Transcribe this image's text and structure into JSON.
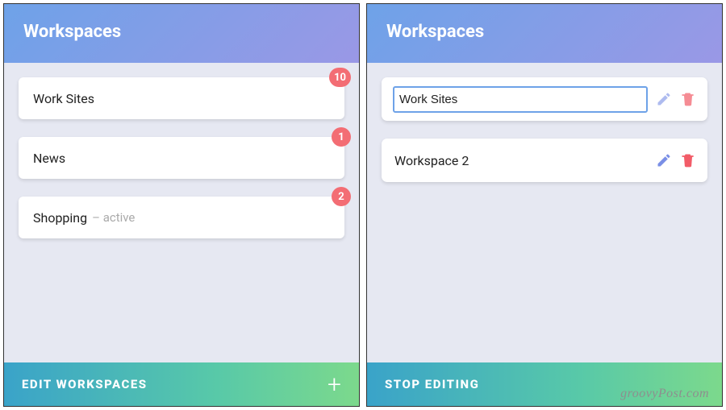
{
  "left": {
    "header_title": "Workspaces",
    "items": [
      {
        "label": "Work Sites",
        "badge": "10",
        "status": ""
      },
      {
        "label": "News",
        "badge": "1",
        "status": ""
      },
      {
        "label": "Shopping",
        "badge": "2",
        "status": "– active"
      }
    ],
    "footer_label": "EDIT WORKSPACES",
    "footer_plus": "+"
  },
  "right": {
    "header_title": "Workspaces",
    "items": [
      {
        "label": "Work Sites",
        "editing": true
      },
      {
        "label": "Workspace 2",
        "editing": false
      }
    ],
    "footer_label": "STOP EDITING"
  },
  "watermark": "groovyPost.com"
}
